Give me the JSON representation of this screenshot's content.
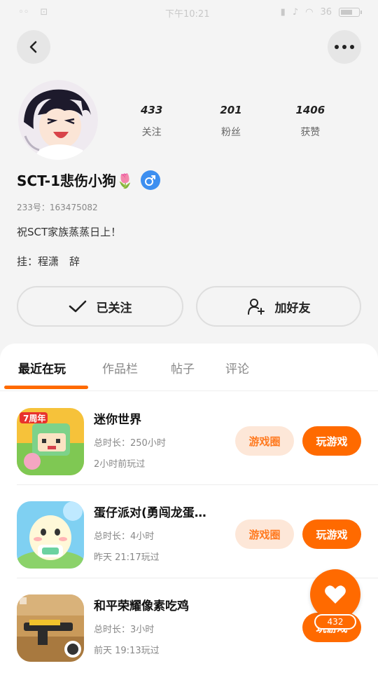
{
  "status_bar": {
    "time": "下午10:21",
    "signal_text": "36",
    "battery_icon": "battery-icon"
  },
  "header": {
    "back_icon": "chevron-left-icon",
    "more_icon": "more-dots-icon"
  },
  "profile": {
    "stats": [
      {
        "value": "433",
        "label": "关注"
      },
      {
        "value": "201",
        "label": "粉丝"
      },
      {
        "value": "1406",
        "label": "获赞"
      }
    ],
    "username": "SCT-1悲伤小狗",
    "username_emoji": "🌷",
    "gender_icon": "male-icon",
    "uid": "233号：163475082",
    "bio": "祝SCT家族蒸蒸日上！",
    "hang": "挂：程潇　辞"
  },
  "actions": {
    "follow_label": "已关注",
    "add_friend_label": "加好友"
  },
  "tabs": [
    {
      "label": "最近在玩",
      "active": true
    },
    {
      "label": "作品栏",
      "active": false
    },
    {
      "label": "帖子",
      "active": false
    },
    {
      "label": "评论",
      "active": false
    }
  ],
  "games": [
    {
      "title": "迷你世界",
      "duration": "总时长：250小时",
      "last_played": "2小时前玩过",
      "circle_label": "游戏圈",
      "play_label": "玩游戏"
    },
    {
      "title": "蛋仔派对(勇闯龙蛋…",
      "duration": "总时长：4小时",
      "last_played": "昨天 21:17玩过",
      "circle_label": "游戏圈",
      "play_label": "玩游戏"
    },
    {
      "title": "和平荣耀像素吃鸡",
      "duration": "总时长：3小时",
      "last_played": "前天 19:13玩过",
      "circle_label": "",
      "play_label": "玩游戏"
    }
  ],
  "like_fab": {
    "icon": "heart-icon",
    "count": "432"
  },
  "colors": {
    "accent": "#ff6a00",
    "accent_light": "#fde7d8",
    "gender_blue": "#3d8ff0"
  }
}
